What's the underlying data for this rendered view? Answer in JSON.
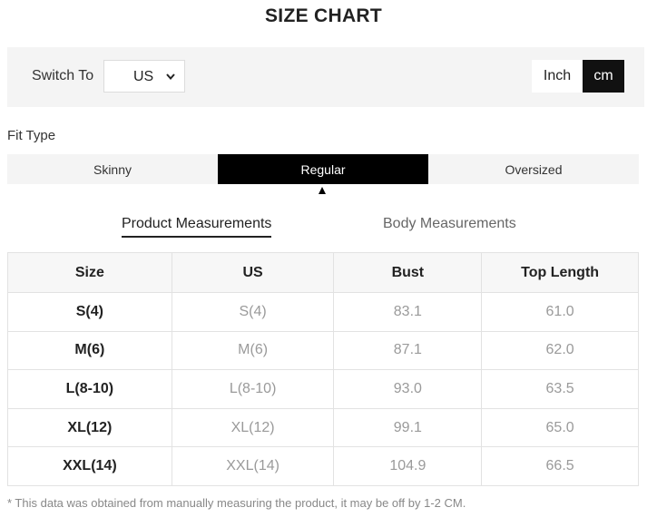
{
  "title": "SIZE CHART",
  "switch": {
    "label": "Switch To",
    "region_value": "US",
    "units": {
      "inch_label": "Inch",
      "cm_label": "cm",
      "active": "cm"
    }
  },
  "fit": {
    "label": "Fit Type",
    "tabs": [
      "Skinny",
      "Regular",
      "Oversized"
    ],
    "active": "Regular"
  },
  "measurements": {
    "tabs": [
      "Product Measurements",
      "Body Measurements"
    ],
    "active": "Product Measurements"
  },
  "table": {
    "headers": [
      "Size",
      "US",
      "Bust",
      "Top Length"
    ],
    "rows": [
      [
        "S(4)",
        "S(4)",
        "83.1",
        "61.0"
      ],
      [
        "M(6)",
        "M(6)",
        "87.1",
        "62.0"
      ],
      [
        "L(8-10)",
        "L(8-10)",
        "93.0",
        "63.5"
      ],
      [
        "XL(12)",
        "XL(12)",
        "99.1",
        "65.0"
      ],
      [
        "XXL(14)",
        "XXL(14)",
        "104.9",
        "66.5"
      ]
    ]
  },
  "footnote": "* This data was obtained from manually measuring the product, it may be off by 1-2 CM.",
  "colors": {
    "active_bg": "#000000",
    "panel_bg": "#f4f4f4",
    "muted_text": "#9a9a9a"
  },
  "icons": {
    "select": "chevron-down-icon",
    "active_fit_marker": "caret-up-icon"
  }
}
